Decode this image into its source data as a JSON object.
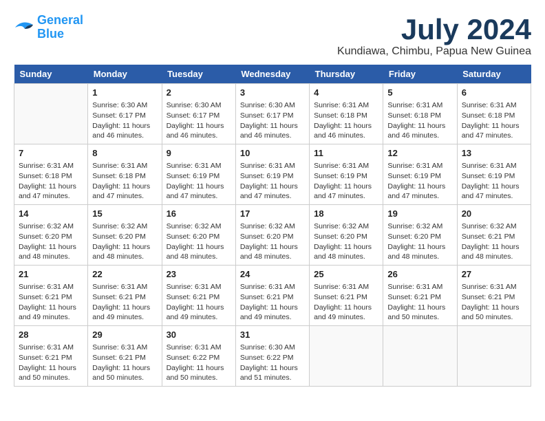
{
  "logo": {
    "line1": "General",
    "line2": "Blue"
  },
  "title": "July 2024",
  "location": "Kundiawa, Chimbu, Papua New Guinea",
  "days_header": [
    "Sunday",
    "Monday",
    "Tuesday",
    "Wednesday",
    "Thursday",
    "Friday",
    "Saturday"
  ],
  "weeks": [
    [
      {
        "day": "",
        "info": ""
      },
      {
        "day": "1",
        "info": "Sunrise: 6:30 AM\nSunset: 6:17 PM\nDaylight: 11 hours\nand 46 minutes."
      },
      {
        "day": "2",
        "info": "Sunrise: 6:30 AM\nSunset: 6:17 PM\nDaylight: 11 hours\nand 46 minutes."
      },
      {
        "day": "3",
        "info": "Sunrise: 6:30 AM\nSunset: 6:17 PM\nDaylight: 11 hours\nand 46 minutes."
      },
      {
        "day": "4",
        "info": "Sunrise: 6:31 AM\nSunset: 6:18 PM\nDaylight: 11 hours\nand 46 minutes."
      },
      {
        "day": "5",
        "info": "Sunrise: 6:31 AM\nSunset: 6:18 PM\nDaylight: 11 hours\nand 46 minutes."
      },
      {
        "day": "6",
        "info": "Sunrise: 6:31 AM\nSunset: 6:18 PM\nDaylight: 11 hours\nand 47 minutes."
      }
    ],
    [
      {
        "day": "7",
        "info": "Sunrise: 6:31 AM\nSunset: 6:18 PM\nDaylight: 11 hours\nand 47 minutes."
      },
      {
        "day": "8",
        "info": "Sunrise: 6:31 AM\nSunset: 6:18 PM\nDaylight: 11 hours\nand 47 minutes."
      },
      {
        "day": "9",
        "info": "Sunrise: 6:31 AM\nSunset: 6:19 PM\nDaylight: 11 hours\nand 47 minutes."
      },
      {
        "day": "10",
        "info": "Sunrise: 6:31 AM\nSunset: 6:19 PM\nDaylight: 11 hours\nand 47 minutes."
      },
      {
        "day": "11",
        "info": "Sunrise: 6:31 AM\nSunset: 6:19 PM\nDaylight: 11 hours\nand 47 minutes."
      },
      {
        "day": "12",
        "info": "Sunrise: 6:31 AM\nSunset: 6:19 PM\nDaylight: 11 hours\nand 47 minutes."
      },
      {
        "day": "13",
        "info": "Sunrise: 6:31 AM\nSunset: 6:19 PM\nDaylight: 11 hours\nand 47 minutes."
      }
    ],
    [
      {
        "day": "14",
        "info": "Sunrise: 6:32 AM\nSunset: 6:20 PM\nDaylight: 11 hours\nand 48 minutes."
      },
      {
        "day": "15",
        "info": "Sunrise: 6:32 AM\nSunset: 6:20 PM\nDaylight: 11 hours\nand 48 minutes."
      },
      {
        "day": "16",
        "info": "Sunrise: 6:32 AM\nSunset: 6:20 PM\nDaylight: 11 hours\nand 48 minutes."
      },
      {
        "day": "17",
        "info": "Sunrise: 6:32 AM\nSunset: 6:20 PM\nDaylight: 11 hours\nand 48 minutes."
      },
      {
        "day": "18",
        "info": "Sunrise: 6:32 AM\nSunset: 6:20 PM\nDaylight: 11 hours\nand 48 minutes."
      },
      {
        "day": "19",
        "info": "Sunrise: 6:32 AM\nSunset: 6:20 PM\nDaylight: 11 hours\nand 48 minutes."
      },
      {
        "day": "20",
        "info": "Sunrise: 6:32 AM\nSunset: 6:21 PM\nDaylight: 11 hours\nand 48 minutes."
      }
    ],
    [
      {
        "day": "21",
        "info": "Sunrise: 6:31 AM\nSunset: 6:21 PM\nDaylight: 11 hours\nand 49 minutes."
      },
      {
        "day": "22",
        "info": "Sunrise: 6:31 AM\nSunset: 6:21 PM\nDaylight: 11 hours\nand 49 minutes."
      },
      {
        "day": "23",
        "info": "Sunrise: 6:31 AM\nSunset: 6:21 PM\nDaylight: 11 hours\nand 49 minutes."
      },
      {
        "day": "24",
        "info": "Sunrise: 6:31 AM\nSunset: 6:21 PM\nDaylight: 11 hours\nand 49 minutes."
      },
      {
        "day": "25",
        "info": "Sunrise: 6:31 AM\nSunset: 6:21 PM\nDaylight: 11 hours\nand 49 minutes."
      },
      {
        "day": "26",
        "info": "Sunrise: 6:31 AM\nSunset: 6:21 PM\nDaylight: 11 hours\nand 50 minutes."
      },
      {
        "day": "27",
        "info": "Sunrise: 6:31 AM\nSunset: 6:21 PM\nDaylight: 11 hours\nand 50 minutes."
      }
    ],
    [
      {
        "day": "28",
        "info": "Sunrise: 6:31 AM\nSunset: 6:21 PM\nDaylight: 11 hours\nand 50 minutes."
      },
      {
        "day": "29",
        "info": "Sunrise: 6:31 AM\nSunset: 6:21 PM\nDaylight: 11 hours\nand 50 minutes."
      },
      {
        "day": "30",
        "info": "Sunrise: 6:31 AM\nSunset: 6:22 PM\nDaylight: 11 hours\nand 50 minutes."
      },
      {
        "day": "31",
        "info": "Sunrise: 6:30 AM\nSunset: 6:22 PM\nDaylight: 11 hours\nand 51 minutes."
      },
      {
        "day": "",
        "info": ""
      },
      {
        "day": "",
        "info": ""
      },
      {
        "day": "",
        "info": ""
      }
    ]
  ]
}
